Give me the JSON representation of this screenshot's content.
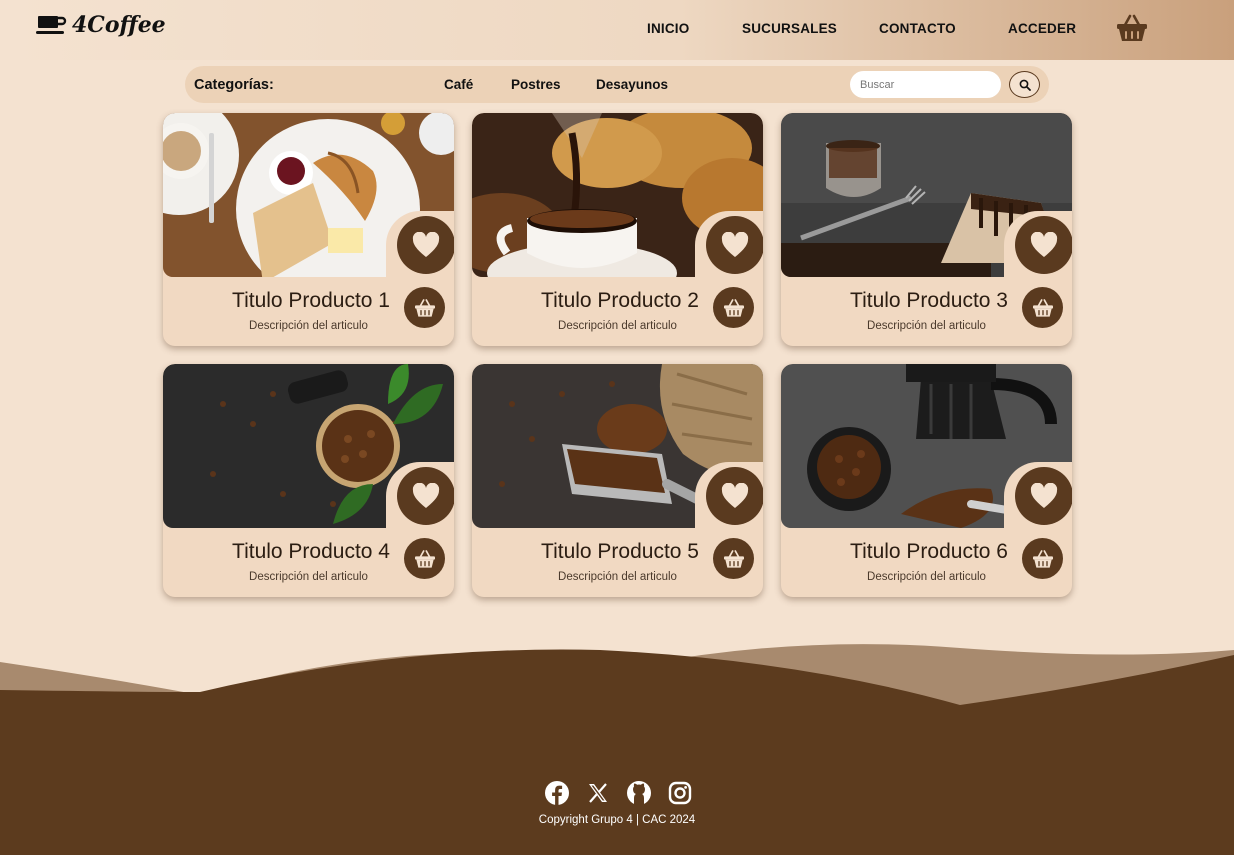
{
  "brand": {
    "logo_text": "4Coffee",
    "icon": "coffee-cup-icon"
  },
  "nav": {
    "items": [
      "INICIO",
      "SUCURSALES",
      "CONTACTO",
      "ACCEDER"
    ],
    "cart_icon": "basket-icon"
  },
  "categories": {
    "title": "Categorías:",
    "items": [
      "Café",
      "Postres",
      "Desayunos"
    ],
    "search_placeholder": "Buscar",
    "search_icon": "search-icon"
  },
  "products": [
    {
      "title": "Titulo Producto 1",
      "desc": "Descripción del articulo",
      "image": "breakfast-croissant-coffee"
    },
    {
      "title": "Titulo Producto 2",
      "desc": "Descripción del articulo",
      "image": "coffee-pouring-bread"
    },
    {
      "title": "Titulo Producto 3",
      "desc": "Descripción del articulo",
      "image": "coffee-cake-slice"
    },
    {
      "title": "Titulo Producto 4",
      "desc": "Descripción del articulo",
      "image": "coffee-beans-bowl-leaves"
    },
    {
      "title": "Titulo Producto 5",
      "desc": "Descripción del articulo",
      "image": "coffee-beans-scoop-sack"
    },
    {
      "title": "Titulo Producto 6",
      "desc": "Descripción del articulo",
      "image": "coffee-beans-moka-pot"
    }
  ],
  "footer": {
    "socials": [
      "facebook-icon",
      "x-icon",
      "github-icon",
      "instagram-icon"
    ],
    "copyright": "Copyright Grupo 4 | CAC 2024"
  },
  "colors": {
    "background": "#f4e2d0",
    "accent_brown": "#5a3a1f",
    "footer": "#5c3b1e",
    "card": "#f1d9c2"
  }
}
